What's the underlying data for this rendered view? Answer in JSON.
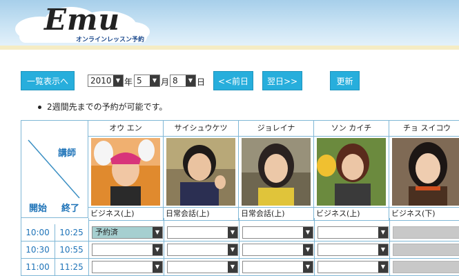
{
  "header": {
    "logo_text": "Emu",
    "logo_subtitle": "オンラインレッスン予約"
  },
  "toolbar": {
    "list_view_label": "一覧表示へ",
    "year_value": "2010",
    "year_unit": "年",
    "month_value": "5",
    "month_unit": "月",
    "day_value": "8",
    "day_unit": "日",
    "prev_label": "<<前日",
    "next_label": "翌日>>",
    "refresh_label": "更新"
  },
  "notice": "2週間先までの予約が可能です。",
  "table": {
    "teacher_label": "講師",
    "start_label": "開始",
    "end_label": "終了",
    "teachers": [
      {
        "name": "オウ エン",
        "course": "ビジネス(上)"
      },
      {
        "name": "サイシュウケツ",
        "course": "日常会話(上)"
      },
      {
        "name": "ジョレイナ",
        "course": "日常会話(上)"
      },
      {
        "name": "ソン カイチ",
        "course": "ビジネス(上)"
      },
      {
        "name": "チョ スイコウ",
        "course": "ビジネス(下)"
      }
    ],
    "rows": [
      {
        "start": "10:00",
        "end": "10:25",
        "slots": [
          "予約済",
          "",
          "",
          "",
          ""
        ]
      },
      {
        "start": "10:30",
        "end": "10:55",
        "slots": [
          "",
          "",
          "",
          "",
          ""
        ]
      },
      {
        "start": "11:00",
        "end": "11:25",
        "slots": [
          "",
          "",
          "",
          "",
          ""
        ]
      }
    ]
  },
  "colors": {
    "accent": "#27aedc",
    "booked": "#a6cfd0",
    "disabled": "#c8c8c8",
    "time_text": "#1e73b8"
  }
}
